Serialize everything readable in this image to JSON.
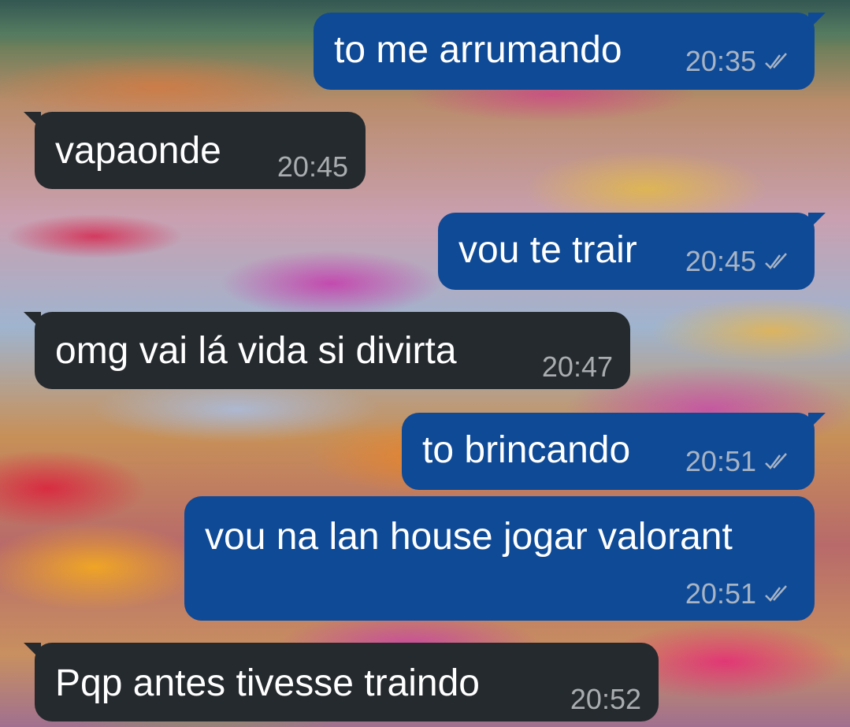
{
  "wallpaper": "flower-field",
  "colors": {
    "outgoing_bubble": "#0f4a97",
    "incoming_bubble": "#252a2e",
    "text": "#ffffff"
  },
  "messages": [
    {
      "direction": "outgoing",
      "text": "to me arrumando",
      "time": "20:35",
      "status_icon": "double-check-icon"
    },
    {
      "direction": "incoming",
      "text": "vapaonde",
      "time": "20:45"
    },
    {
      "direction": "outgoing",
      "text": "vou te trair",
      "time": "20:45",
      "status_icon": "double-check-icon"
    },
    {
      "direction": "incoming",
      "text": "omg vai lá vida si divirta",
      "time": "20:47"
    },
    {
      "direction": "outgoing",
      "text": "to brincando",
      "time": "20:51",
      "status_icon": "double-check-icon"
    },
    {
      "direction": "outgoing",
      "text": "vou na lan house jogar valorant",
      "time": "20:51",
      "status_icon": "double-check-icon"
    },
    {
      "direction": "incoming",
      "text": "Pqp antes tivesse traindo",
      "time": "20:52"
    }
  ]
}
